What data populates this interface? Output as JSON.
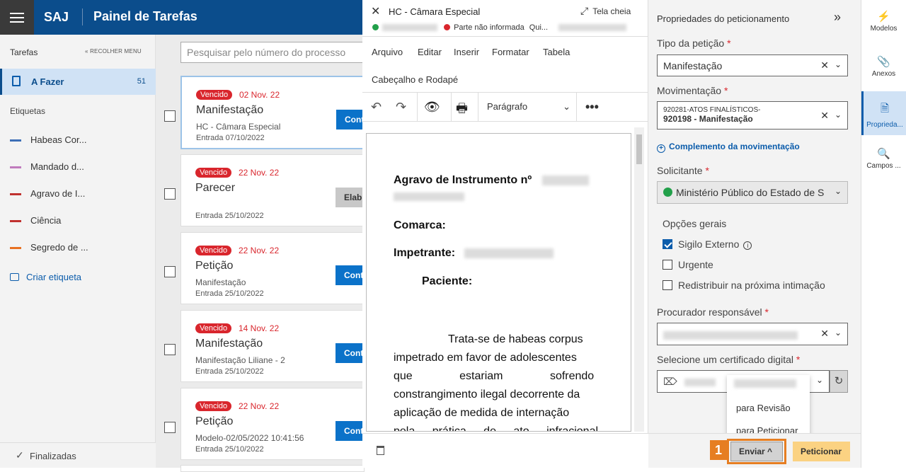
{
  "app": {
    "brand": "SAJ",
    "title": "Painel de Tarefas"
  },
  "sidebar": {
    "header": "Tarefas",
    "collapse": "RECOLHER MENU",
    "active": {
      "label": "A Fazer",
      "count": "51"
    },
    "tags_header": "Etiquetas",
    "tags": [
      {
        "label": "Habeas Cor...",
        "color": "#3d6fb6"
      },
      {
        "label": "Mandado d...",
        "color": "#c07bbd"
      },
      {
        "label": "Agravo de I...",
        "color": "#c0312f"
      },
      {
        "label": "Ciência",
        "color": "#c0312f"
      },
      {
        "label": "Segredo de ...",
        "color": "#e87122"
      }
    ],
    "create": "Criar etiqueta",
    "footer": "Finalizadas"
  },
  "list": {
    "search_placeholder": "Pesquisar pelo número do processo",
    "cards": [
      {
        "badge": "Vencido",
        "date": "02 Nov. 22",
        "title": "Manifestação",
        "sub": "HC - Câmara Especial",
        "entry": "Entrada 07/10/2022",
        "btn": "Cont"
      },
      {
        "badge": "Vencido",
        "date": "22 Nov. 22",
        "title": "Parecer",
        "sub": "",
        "entry": "Entrada 25/10/2022",
        "btn": "Elab"
      },
      {
        "badge": "Vencido",
        "date": "22 Nov. 22",
        "title": "Petição",
        "sub": "Manifestação",
        "entry": "Entrada 25/10/2022",
        "btn": "Cont"
      },
      {
        "badge": "Vencido",
        "date": "14 Nov. 22",
        "title": "Manifestação",
        "sub": "Manifestação Liliane - 2",
        "entry": "Entrada 25/10/2022",
        "btn": "Cont"
      },
      {
        "badge": "Vencido",
        "date": "22 Nov. 22",
        "title": "Petição",
        "sub": "Modelo-02/05/2022 10:41:56",
        "entry": "Entrada 25/10/2022",
        "btn": "Cont"
      }
    ]
  },
  "editor": {
    "title": "HC - Câmara Especial",
    "fullscreen": "Tela cheia",
    "party_missing": "Parte não informada",
    "party_extra": "Qui...",
    "menu": [
      "Arquivo",
      "Editar",
      "Inserir",
      "Formatar",
      "Tabela"
    ],
    "submenu": "Cabeçalho e Rodapé",
    "paragraph": "Parágrafo",
    "doc": {
      "agravo": "Agravo de Instrumento nº",
      "comarca": "Comarca:",
      "impetrante": "Impetrante:",
      "paciente": "Paciente:",
      "body": [
        "Trata-se de habeas corpus",
        "impetrado em favor de adolescentes",
        "que estariam sofrendo",
        "constrangimento ilegal decorrente da",
        "aplicação de medida de internação",
        "pela prática de ato infracional"
      ]
    }
  },
  "props": {
    "header": "Propriedades do peticionamento",
    "tipo_label": "Tipo da petição",
    "tipo_value": "Manifestação",
    "mov_label": "Movimentação",
    "mov_line1": "920281-ATOS FINALÍSTICOS-",
    "mov_line2": "920198 - Manifestação",
    "complemento": "Complemento da movimentação",
    "solicitante_label": "Solicitante",
    "solicitante_value": "Ministério Público do Estado de S",
    "opcoes_label": "Opções gerais",
    "opt_sigilo": "Sigilo Externo",
    "opt_urgente": "Urgente",
    "opt_redistribuir": "Redistribuir na próxima intimação",
    "procurador_label": "Procurador responsável",
    "certificado_label": "Selecione um certificado digital",
    "dropdown": [
      "para Revisão",
      "para Peticionar"
    ],
    "enviar": "Enviar",
    "peticionar": "Peticionar",
    "step": "1"
  },
  "rail": [
    {
      "label": "Modelos",
      "icon": "lightning-icon"
    },
    {
      "label": "Anexos",
      "icon": "paperclip-icon"
    },
    {
      "label": "Proprieda...",
      "icon": "document-icon"
    },
    {
      "label": "Campos ...",
      "icon": "search-document-icon"
    }
  ]
}
